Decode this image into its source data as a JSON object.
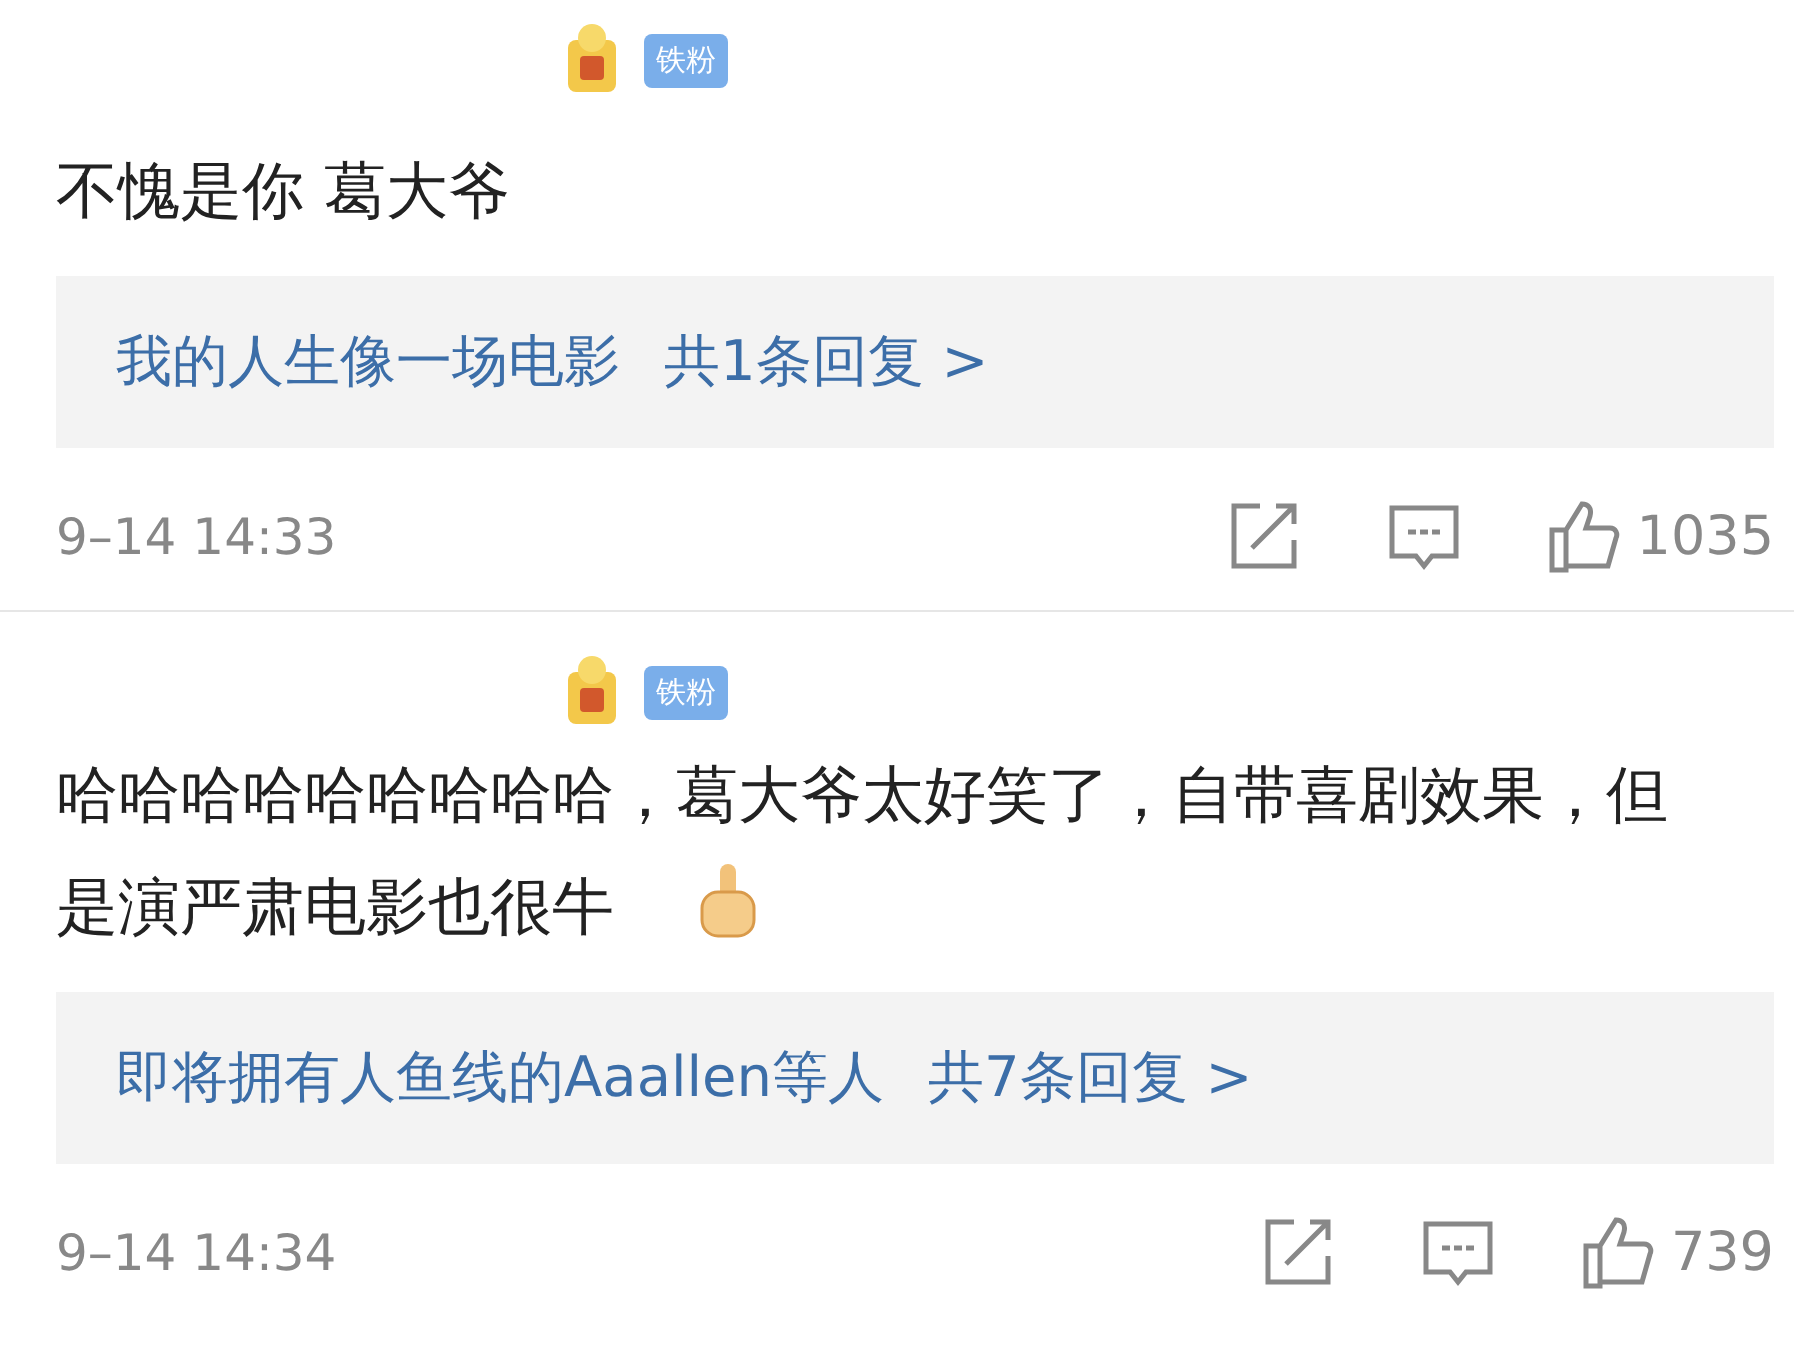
{
  "comments": [
    {
      "badge": "铁粉",
      "text": "不愧是你 葛大爷",
      "thumbs_emoji": false,
      "reply": {
        "users": "我的人生像一场电影",
        "count": "共1条回复 >"
      },
      "time": "9–14 14:33",
      "likes": "1035"
    },
    {
      "badge": "铁粉",
      "text": "哈哈哈哈哈哈哈哈哈，葛大爷太好笑了，自带喜剧效果，但是演严肃电影也很牛",
      "thumbs_emoji": true,
      "reply": {
        "users": "即将拥有人鱼线的Aaallen等人",
        "count": "共7条回复 >"
      },
      "time": "9–14 14:34",
      "likes": "739"
    }
  ]
}
